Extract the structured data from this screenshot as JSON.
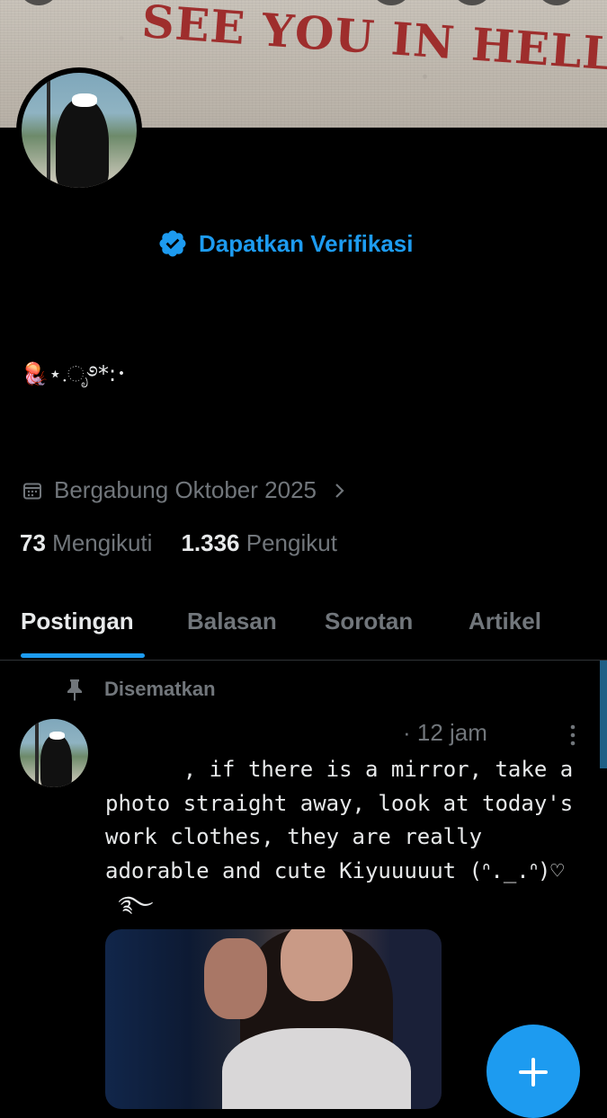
{
  "banner": {
    "text": "SEE YOU IN HELL"
  },
  "profile": {
    "verify_label": "Dapatkan Verifikasi",
    "bio": "🪼⋆.ೃ࿔*:･",
    "joined": "Bergabung Oktober 2025",
    "following_count": "73",
    "following_label": "Mengikuti",
    "followers_count": "1.336",
    "followers_label": "Pengikut"
  },
  "tabs": [
    {
      "label": "Postingan",
      "active": true
    },
    {
      "label": "Balasan",
      "active": false
    },
    {
      "label": "Sorotan",
      "active": false
    },
    {
      "label": "Artikel",
      "active": false
    }
  ],
  "post": {
    "pinned_label": "Disematkan",
    "time": "· 12 jam",
    "text": "      , if there is a mirror, take a\nphoto straight away, look at today's\nwork clothes, they are really\nadorable and cute Kiyuuuuut (ᐢ._.ᐢ)♡\n ࿐"
  },
  "colors": {
    "accent": "#1d9bf0",
    "muted": "#71767b",
    "background": "#000000",
    "text": "#e7e9ea",
    "banner_text": "#9b1f1f"
  },
  "icons": {
    "verified": "verified-badge-icon",
    "calendar": "calendar-icon",
    "chevron": "chevron-right-icon",
    "pin": "pin-icon",
    "more": "more-vertical-icon",
    "compose": "plus-icon"
  }
}
